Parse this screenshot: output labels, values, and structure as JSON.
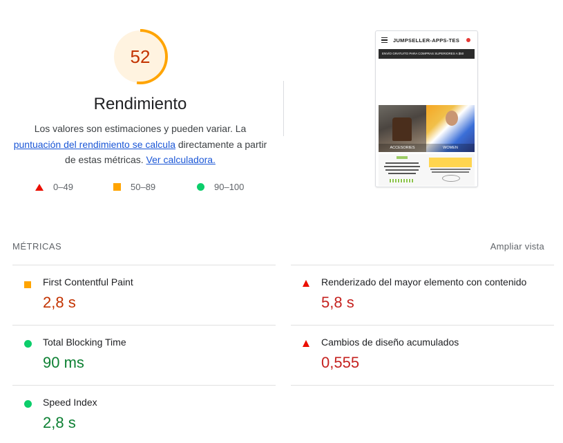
{
  "performance": {
    "score": "52",
    "score_fraction": 0.52,
    "title": "Rendimiento",
    "description_prefix": "Los valores son estimaciones y pueden variar. La ",
    "description_link1": "puntuación del rendimiento se calcula",
    "description_middle": " directamente a partir de estas métricas. ",
    "description_link2": "Ver calculadora."
  },
  "legend": [
    {
      "range": "0–49",
      "icon": "triangle-red"
    },
    {
      "range": "50–89",
      "icon": "square-orange"
    },
    {
      "range": "90–100",
      "icon": "circle-green"
    }
  ],
  "screenshot": {
    "brand": "JUMPSELLER-APPS-TES",
    "banner": "ENVÍO GRATUITO PARA COMPRAS SUPERIORES A $50",
    "tile1": "ACCESORIES",
    "tile2": "WOMEN"
  },
  "metrics": {
    "title": "MÉTRICAS",
    "expand_label": "Ampliar vista",
    "items": [
      {
        "name": "First Contentful Paint",
        "value": "2,8 s",
        "status": "average"
      },
      {
        "name": "Renderizado del mayor elemento con contenido",
        "value": "5,8 s",
        "status": "fail"
      },
      {
        "name": "Total Blocking Time",
        "value": "90 ms",
        "status": "pass"
      },
      {
        "name": "Cambios de diseño acumulados",
        "value": "0,555",
        "status": "fail"
      },
      {
        "name": "Speed Index",
        "value": "2,8 s",
        "status": "pass"
      }
    ]
  },
  "colors": {
    "fail": "#eb0f00",
    "average": "#ffa400",
    "pass": "#0cce6b",
    "gauge_bg": "#fff3e0",
    "link": "#1a56d6"
  }
}
